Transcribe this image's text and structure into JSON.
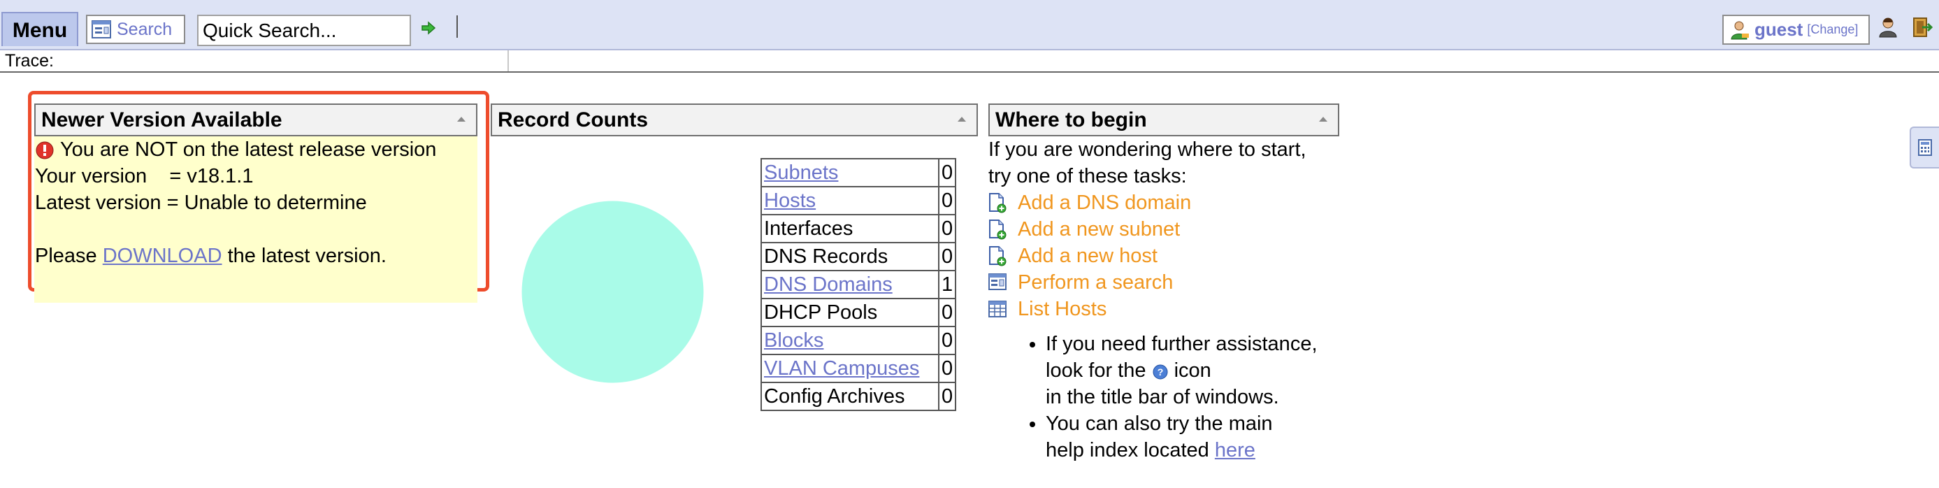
{
  "header": {
    "menu_label": "Menu",
    "search_label": "Search",
    "quick_search_placeholder": "Quick Search...",
    "go_icon": "green-arrow-icon",
    "user_name": "guest",
    "user_change": "[Change]",
    "user_icon": "user-icon",
    "logout_icon": "logout-icon"
  },
  "trace": {
    "label": "Trace:"
  },
  "newer_version": {
    "title": "Newer Version Available",
    "warning": "You are NOT on the latest release version",
    "your_version": "Your version    = v18.1.1",
    "latest_version": "Latest version = Unable to determine",
    "please": "Please",
    "download_link": "DOWNLOAD",
    "after_link": "the latest version."
  },
  "record_counts": {
    "title": "Record Counts",
    "rows": [
      {
        "name": "Subnets",
        "count": "0",
        "link": true
      },
      {
        "name": "Hosts",
        "count": "0",
        "link": true
      },
      {
        "name": "Interfaces",
        "count": "0",
        "link": false
      },
      {
        "name": "DNS Records",
        "count": "0",
        "link": false
      },
      {
        "name": "DNS Domains",
        "count": "1",
        "link": true
      },
      {
        "name": "DHCP Pools",
        "count": "0",
        "link": false
      },
      {
        "name": "Blocks",
        "count": "0",
        "link": true
      },
      {
        "name": "VLAN Campuses",
        "count": "0",
        "link": true
      },
      {
        "name": "Config Archives",
        "count": "0",
        "link": false
      }
    ],
    "pie_color": "#a9fbe8"
  },
  "where_to_begin": {
    "title": "Where to begin",
    "intro_line1": "If you are wondering where to start,",
    "intro_line2": "try one of these tasks:",
    "tasks": [
      {
        "label": "Add a DNS domain",
        "icon": "add-document-icon"
      },
      {
        "label": "Add a new subnet",
        "icon": "add-document-icon"
      },
      {
        "label": "Add a new host",
        "icon": "add-document-icon"
      },
      {
        "label": "Perform a search",
        "icon": "search-form-icon"
      },
      {
        "label": "List Hosts",
        "icon": "table-icon"
      }
    ],
    "tip1_line1": "If you need further assistance,",
    "tip1_before_icon": "look for the",
    "tip1_after_icon": "icon",
    "tip1_line3": "in the title bar of windows.",
    "tip2_line1": "You can also try the main",
    "tip2_before_link": "help index located",
    "tip2_link": "here"
  },
  "colors": {
    "link": "#6b74c9",
    "task_link": "#f0961e",
    "highlight_frame": "#ee4c2c",
    "notice_background": "#ffffcc",
    "topbar": "#dde3f5"
  }
}
